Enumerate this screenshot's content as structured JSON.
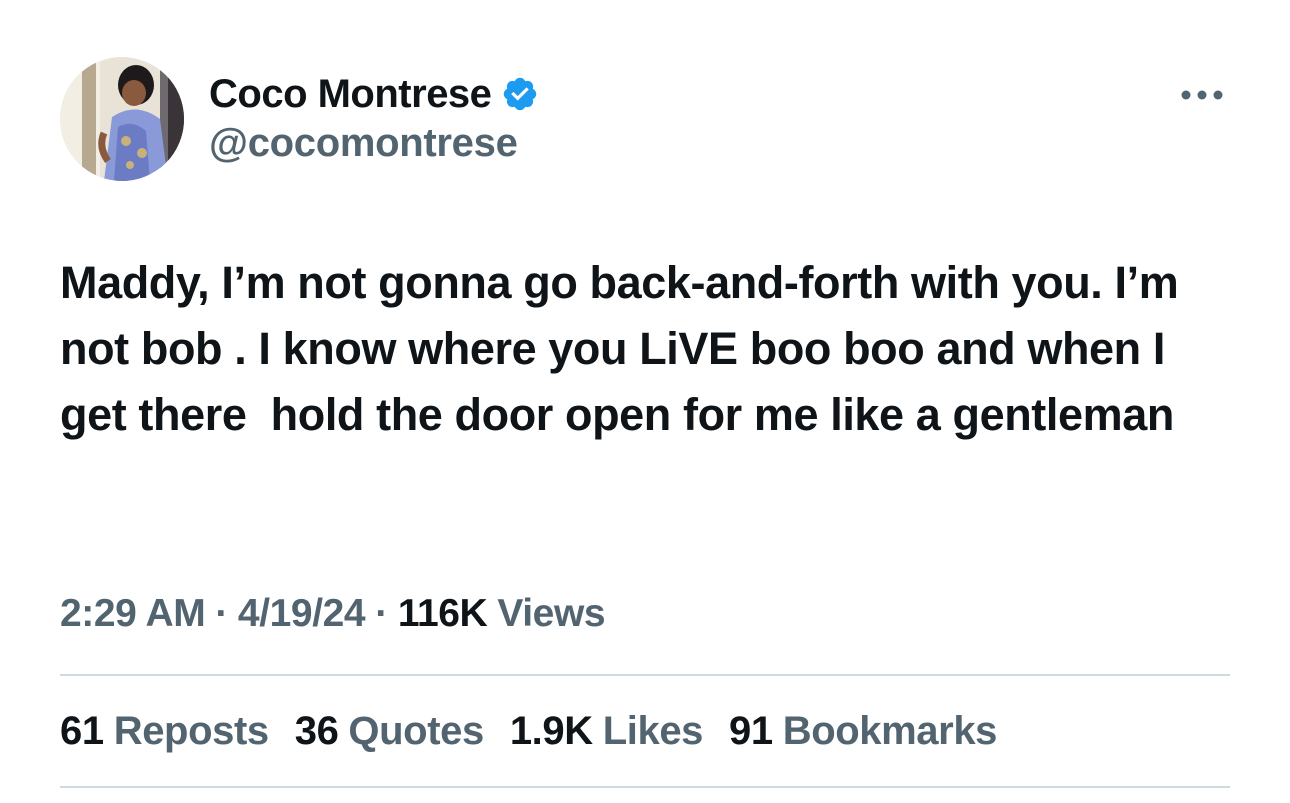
{
  "author": {
    "display_name": "Coco Montrese",
    "handle": "@cocomontrese",
    "verified": true,
    "verified_color": "#1d9bf0",
    "avatar_icon": "profile-photo"
  },
  "more_icon": "more-horizontal-icon",
  "tweet": {
    "text": "Maddy, I’m not gonna go back-and-forth with you. I’m not bob . I know where you LiVE boo boo and when I get there  hold the door open for me like a gentleman"
  },
  "meta": {
    "time": "2:29 AM",
    "separator": "·",
    "date": "4/19/24",
    "views_count": "116K",
    "views_label": "Views"
  },
  "stats": [
    {
      "count": "61",
      "label": "Reposts"
    },
    {
      "count": "36",
      "label": "Quotes"
    },
    {
      "count": "1.9K",
      "label": "Likes"
    },
    {
      "count": "91",
      "label": "Bookmarks"
    }
  ],
  "colors": {
    "text_primary": "#0f1419",
    "text_secondary": "#536471",
    "divider": "#cfd9de"
  }
}
